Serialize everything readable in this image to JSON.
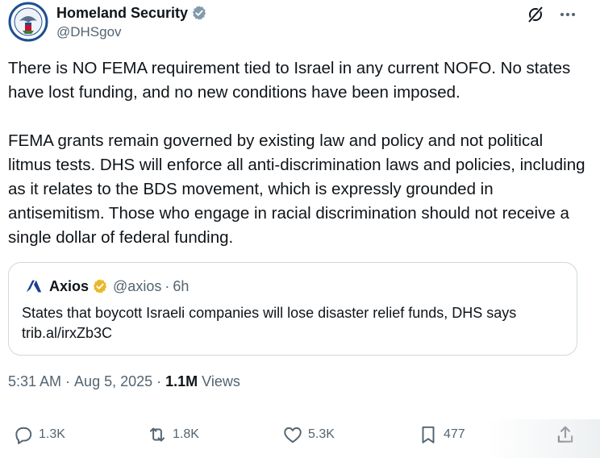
{
  "author": {
    "display_name": "Homeland Security",
    "handle": "@DHSgov",
    "verified_color": "#829aab"
  },
  "tweet": {
    "paragraphs": [
      "There is NO FEMA requirement tied to Israel in any current NOFO. No states have lost funding, and no new conditions have been imposed.",
      "FEMA grants remain governed by existing law and policy and not political litmus tests. DHS will enforce all anti-discrimination laws and policies, including as it relates to the BDS movement, which is expressly grounded in antisemitism. Those who engage in racial discrimination should not receive a single dollar of federal funding."
    ]
  },
  "quote": {
    "name": "Axios",
    "handle": "@axios",
    "separator": "·",
    "age": "6h",
    "text_line1": "States that boycott Israeli companies will lose disaster relief funds, DHS says",
    "text_line2": "trib.al/irxZb3C",
    "verified_color": "#e8b829"
  },
  "meta": {
    "time": "5:31 AM",
    "sep1": " · ",
    "date": "Aug 5, 2025",
    "sep2": " · ",
    "views_count": "1.1M",
    "views_label": " Views"
  },
  "actions": {
    "reply_count": "1.3K",
    "repost_count": "1.8K",
    "like_count": "5.3K",
    "bookmark_count": "477"
  },
  "icons": {
    "reply": "reply-icon",
    "repost": "repost-icon",
    "like": "heart-icon",
    "bookmark": "bookmark-icon",
    "share": "share-icon",
    "grok": "grok-icon",
    "more": "more-icon"
  }
}
